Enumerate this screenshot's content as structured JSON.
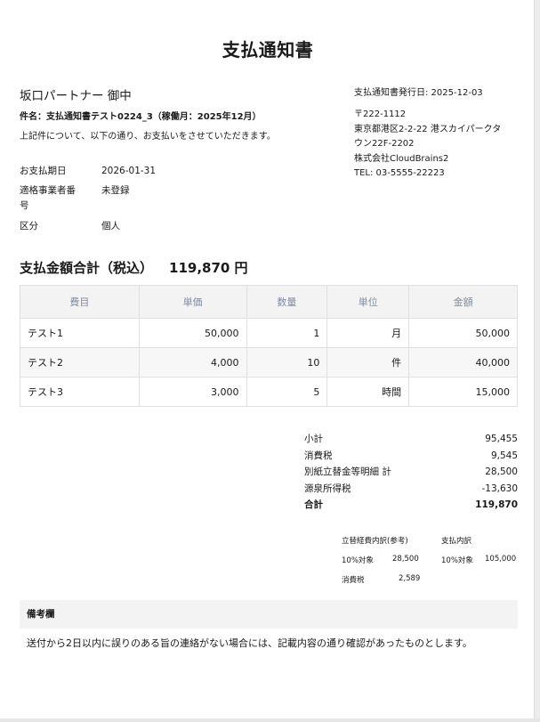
{
  "document": {
    "title": "支払通知書",
    "recipient": "坂口パートナー 御中",
    "subject": "件名：支払通知書テスト0224_3（稼働月：2025年12月）",
    "intro": "上記件について、以下の通り、お支払いをさせていただきます。"
  },
  "info": {
    "due_label": "お支払期日",
    "due_value": "2026-01-31",
    "invoice_label_1": "適格事業者番",
    "invoice_label_2": "号",
    "invoice_value": "未登録",
    "category_label": "区分",
    "category_value": "個人"
  },
  "issuer": {
    "issue_date": "支払通知書発行日: 2025-12-03",
    "postal": "〒222-1112",
    "address_1": "東京都港区2-2-22 港スカイパークタ",
    "address_2": "ウン22F-2202",
    "company": "株式会社CloudBrains2",
    "tel": "TEL: 03-5555-22223"
  },
  "total": {
    "label": "支払金額合計（税込）",
    "amount": "119,870 円"
  },
  "table": {
    "headers": [
      "費目",
      "単価",
      "数量",
      "単位",
      "金額"
    ],
    "rows": [
      {
        "item": "テスト1",
        "unit_price": "50,000",
        "qty": "1",
        "unit": "月",
        "amount": "50,000"
      },
      {
        "item": "テスト2",
        "unit_price": "4,000",
        "qty": "10",
        "unit": "件",
        "amount": "40,000"
      },
      {
        "item": "テスト3",
        "unit_price": "3,000",
        "qty": "5",
        "unit": "時間",
        "amount": "15,000"
      }
    ]
  },
  "summary": {
    "subtotal_label": "小計",
    "subtotal_value": "95,455",
    "tax_label": "消費税",
    "tax_value": "9,545",
    "reimb_label": "別紙立替金等明細 計",
    "reimb_value": "28,500",
    "withholding_label": "源泉所得税",
    "withholding_value": "-13,630",
    "grand_label": "合計",
    "grand_value": "119,870"
  },
  "breakdown": {
    "expense_title": "立替経費内訳(参考)",
    "expense_10_label": "10%対象",
    "expense_10_value": "28,500",
    "expense_tax_label": "消費税",
    "expense_tax_value": "2,589",
    "payment_title": "支払内訳",
    "payment_10_label": "10%対象",
    "payment_10_value": "105,000"
  },
  "remarks": {
    "title": "備考欄",
    "body": "送付から2日以内に誤りのある旨の連絡がない場合には、記載内容の通り確認があったものとします。"
  }
}
